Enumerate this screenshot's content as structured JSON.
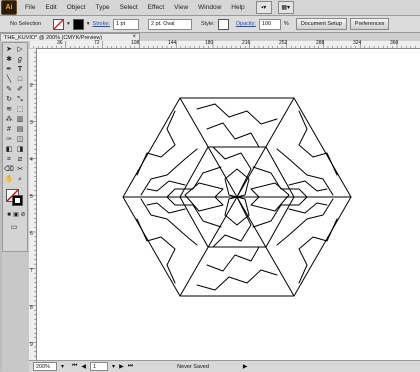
{
  "app": {
    "logo": "Ai"
  },
  "menu": [
    "File",
    "Edit",
    "Object",
    "Type",
    "Select",
    "Effect",
    "View",
    "Window",
    "Help"
  ],
  "control_bar": {
    "selection": "No Selection",
    "stroke_label": "Stroke:",
    "stroke_value": "1 pt",
    "brush": "2 pt. Oval",
    "style_label": "Style:",
    "opacity_label": "Opacity:",
    "opacity_value": "100",
    "percent": "%",
    "document_setup": "Document Setup",
    "preferences": "Preferences"
  },
  "document_tab": {
    "title": "THE_KUVIO* @ 200% (CMYK/Preview)",
    "close": "×"
  },
  "ruler_top": [
    "36",
    "72",
    "108",
    "144",
    "180",
    "216",
    "252",
    "288",
    "324",
    "360"
  ],
  "ruler_left": [
    "2",
    "3",
    "4",
    "5",
    "6",
    "7",
    "8",
    "9"
  ],
  "status": {
    "zoom": "200%",
    "page": "1",
    "save_state": "Never Saved"
  },
  "colors": {
    "ui_gray": "#d6d6d6",
    "canvas": "#ffffff",
    "stroke": "#000000",
    "accent": "#1b4fbf"
  }
}
